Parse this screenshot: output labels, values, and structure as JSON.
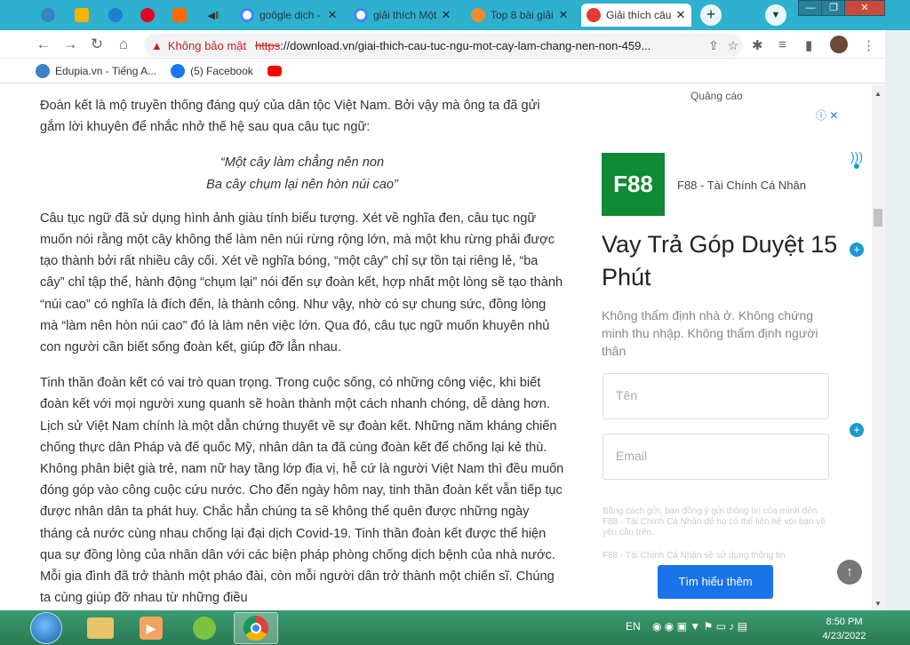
{
  "tabs": [
    {
      "title": "",
      "icon": "edupia-icon",
      "color": "#3b82c4",
      "pinned": true
    },
    {
      "title": "",
      "icon": "h-icon",
      "color": "#f4b400",
      "pinned": true
    },
    {
      "title": "",
      "icon": "chat-icon",
      "color": "#1d7fd1",
      "pinned": true
    },
    {
      "title": "",
      "icon": "pinterest-icon",
      "color": "#e60023",
      "pinned": true
    },
    {
      "title": "",
      "icon": "w-icon",
      "color": "#ff6a00",
      "pinned": true
    },
    {
      "title": "",
      "icon": "speaker-icon",
      "color": "#555555",
      "pinned": true
    },
    {
      "title": "goôgle dịch -",
      "icon": "google-icon",
      "color": "#4285f4",
      "pinned": false
    },
    {
      "title": "giải thích Một",
      "icon": "google-icon",
      "color": "#4285f4",
      "pinned": false
    },
    {
      "title": "Top 8 bài giải",
      "icon": "gear-site-icon",
      "color": "#f28b30",
      "pinned": false
    },
    {
      "title": "Giải thích câu",
      "icon": "download-site-icon",
      "color": "#e53935",
      "pinned": false
    }
  ],
  "toolbar": {
    "not_secure": "Không bảo mật",
    "url_protocol": "https",
    "url_rest": "://download.vn/giai-thich-cau-tuc-ngu-mot-cay-lam-chang-nen-non-459..."
  },
  "bookmarks": [
    {
      "label": "Edupia.vn - Tiếng A...",
      "color": "#3b82c4"
    },
    {
      "label": "(5) Facebook",
      "color": "#1877f2"
    },
    {
      "label": "",
      "color": "#ff0000"
    }
  ],
  "article": {
    "p1": "Đoàn kết là mộ truyền thống đáng quý của dân tộc Việt Nam. Bởi vậy mà ông ta đã gửi gắm lời khuyên để nhắc nhở thế hệ sau qua câu tục ngữ:",
    "quote1": "“Một cây làm chẳng nên non",
    "quote2": "Ba cây chụm lại nên hòn núi cao”",
    "p2": "Câu tục ngữ đã sử dụng hình ảnh giàu tính biểu tượng. Xét về nghĩa đen, câu tục ngữ muốn nói rằng một cây không thể làm nên núi rừng rộng lớn, mà một khu rừng phải được tạo thành bởi rất nhiều cây cối. Xét về nghĩa bóng, “một cây” chỉ sự tồn tại riêng lẻ, “ba cây” chỉ tập thể, hành động “chụm lại” nói đến sự đoàn kết, hợp nhất một lòng sẽ tạo thành “núi cao” có nghĩa là đích đến, là thành công. Như vậy, nhờ có sự chung sức, đồng lòng mà “làm nên hòn núi cao” đó là làm nên việc lớn. Qua đó, câu tục ngữ muốn khuyên nhủ con người cần biết sống đoàn kết, giúp đỡ lẫn nhau.",
    "p3": "Tinh thần đoàn kết có vai trò quan trọng. Trong cuộc sống, có những công việc, khi biết đoàn kết với mọi người xung quanh sẽ hoàn thành một cách nhanh chóng, dễ dàng hơn. Lịch sử Việt Nam chính là một dẫn chứng thuyết về sự đoàn kết. Những năm kháng chiến chống thực dân Pháp và đế quốc Mỹ, nhân dân ta đã cùng đoàn kết để chống lại kẻ thù. Không phân biệt già trẻ, nam nữ hay tầng lớp địa vị, hễ cứ là người Việt Nam thì đều muốn đóng góp vào công cuộc cứu nước. Cho đến ngày hôm nay, tinh thần đoàn kết vẫn tiếp tục được nhân dân ta phát huy. Chắc hẳn chúng ta sẽ không thể quên được những ngày tháng cả nước cùng nhau chống lại đại dịch Covid-19. Tinh thần đoàn kết được thể hiện qua sự đồng lòng của nhân dân với các biện pháp phòng chống dịch bệnh của nhà nước. Mỗi gia đình đã trở thành một pháo đài, còn mỗi người dân trở thành một chiến sĩ. Chúng ta cùng giúp đỡ nhau từ những điều"
  },
  "ad": {
    "label": "Quảng cáo",
    "logo": "F88",
    "brand": "F88 - Tài Chính Cá Nhân",
    "headline": "Vay Trả Góp Duyệt 15 Phút",
    "description": "Không thẩm định nhà ở. Không chứng minh thu nhập. Không thẩm định người thân",
    "name_placeholder": "Tên",
    "email_placeholder": "Email",
    "fine1": "Bằng cách gửi, bạn đồng ý gửi thông tin của mình đến F88 - Tài Chính Cá Nhân để họ có thể liên hệ với bạn về yêu cầu trên.",
    "fine2": "F88 - Tài Chính Cá Nhân sẽ sử dụng thông tin",
    "cta": "Tìm hiểu thêm"
  },
  "taskbar": {
    "lang": "EN",
    "time": "8:50 PM",
    "date": "4/23/2022"
  }
}
